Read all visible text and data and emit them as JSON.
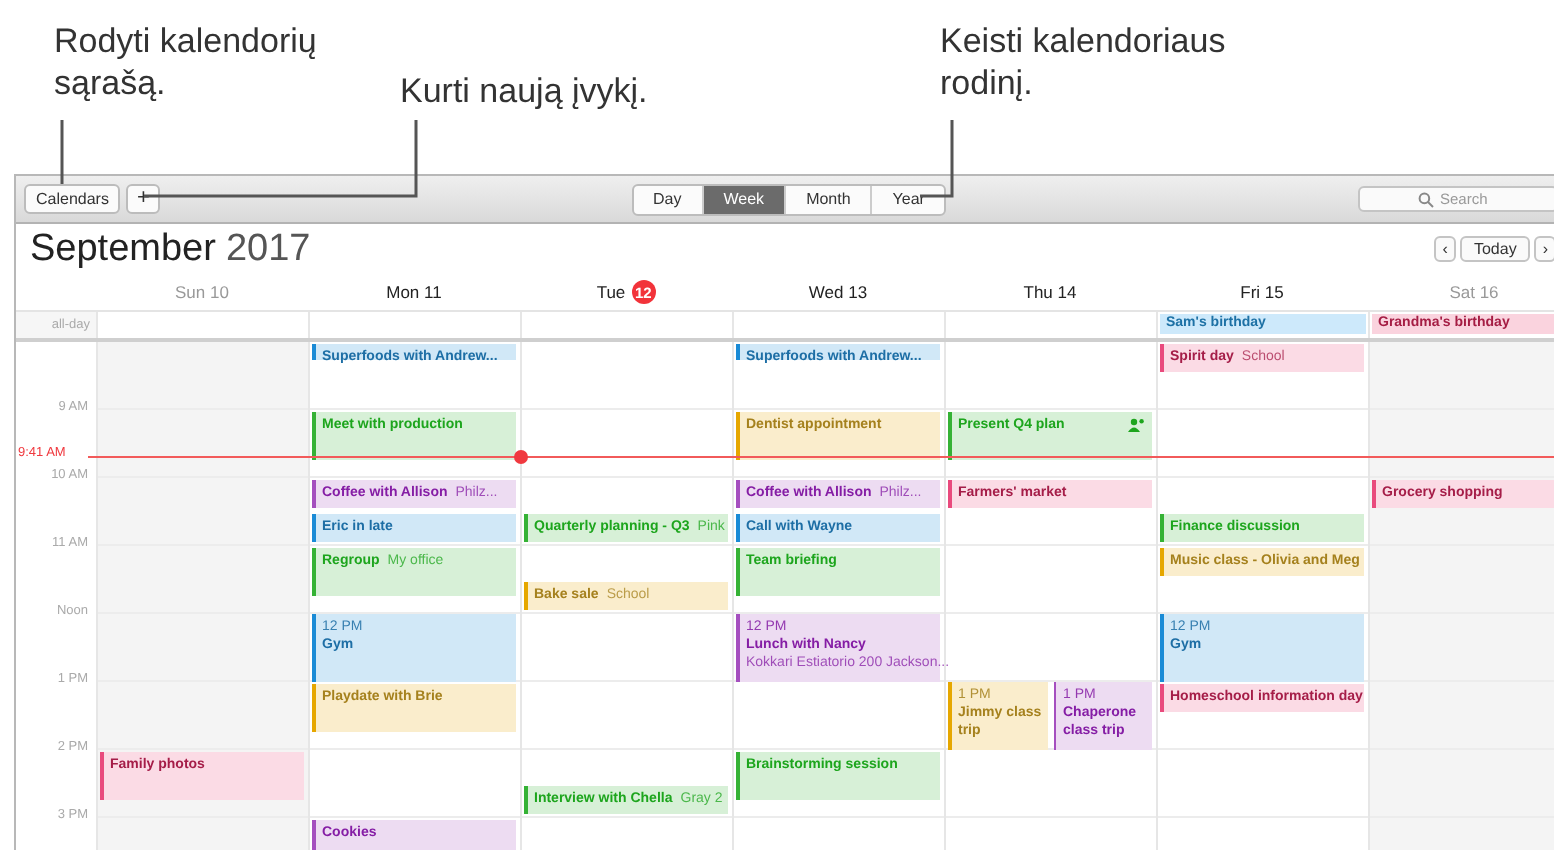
{
  "annotations": [
    {
      "text": "Rodyti kalendorių sąrašą."
    },
    {
      "text": "Kurti naują įvykį."
    },
    {
      "text": "Keisti kalendoriaus rodinį."
    }
  ],
  "toolbar": {
    "calendars_button": "Calendars",
    "add_button": "+",
    "views": [
      {
        "label": "Day",
        "selected": false
      },
      {
        "label": "Week",
        "selected": true
      },
      {
        "label": "Month",
        "selected": false
      },
      {
        "label": "Year",
        "selected": false
      }
    ],
    "search": {
      "placeholder": "Search"
    }
  },
  "header": {
    "month": "September",
    "year": "2017",
    "prev": "‹",
    "today_button": "Today",
    "next": "›"
  },
  "all_day_label": "all-day",
  "days": [
    {
      "weekday": "Sun",
      "date": "10",
      "weekend": true,
      "today": false
    },
    {
      "weekday": "Mon",
      "date": "11",
      "weekend": false,
      "today": false
    },
    {
      "weekday": "Tue",
      "date": "12",
      "weekend": false,
      "today": true
    },
    {
      "weekday": "Wed",
      "date": "13",
      "weekend": false,
      "today": false
    },
    {
      "weekday": "Thu",
      "date": "14",
      "weekend": false,
      "today": false
    },
    {
      "weekday": "Fri",
      "date": "15",
      "weekend": false,
      "today": false,
      "all_day": [
        {
          "title": "Sam's birthday",
          "color": "#cde9fb"
        }
      ]
    },
    {
      "weekday": "Sat",
      "date": "16",
      "weekend": true,
      "today": false,
      "all_day": [
        {
          "title": "Grandma's birthday",
          "color": "#fad3de"
        }
      ]
    }
  ],
  "now": {
    "label": "9:41 AM"
  },
  "rows": [
    {
      "cells": [
        {},
        {
          "events": [
            {
              "title": "Superfoods with Andrew...",
              "color": "#1a8bd6",
              "kind": "brief",
              "half_past": false,
              "invitees": false
            }
          ]
        },
        {},
        {
          "events": [
            {
              "title": "Superfoods with Andrew...",
              "color": "#1a8bd6",
              "kind": "brief",
              "half_past": false,
              "invitees": false
            }
          ]
        },
        {},
        {
          "events": [
            {
              "title": "Spirit day",
              "location": "School",
              "color": "#e94a7d",
              "kind": "short",
              "half_past": false,
              "invitees": false
            }
          ]
        },
        {}
      ]
    },
    {
      "label": "9 AM",
      "cells": [
        {},
        {
          "events": [
            {
              "title": "Meet with production",
              "color": "#35b235",
              "kind": "long",
              "half_past": false,
              "invitees": false
            }
          ]
        },
        {},
        {
          "events": [
            {
              "title": "Dentist appointment",
              "color": "#e6a700",
              "kind": "long",
              "half_past": false,
              "invitees": false
            }
          ]
        },
        {
          "events": [
            {
              "title": "Present Q4 plan",
              "color": "#35b235",
              "kind": "long",
              "half_past": false,
              "invitees": true
            }
          ]
        },
        {},
        {}
      ]
    },
    {
      "label": "10 AM",
      "cells": [
        {},
        {
          "events": [
            {
              "title": "Coffee with Allison",
              "location": "Philz...",
              "color": "#a54fbf",
              "kind": "short",
              "half_past": false,
              "invitees": false
            },
            {
              "title": "Eric in late",
              "color": "#1a8bd6",
              "kind": "short",
              "half_past": true,
              "invitees": false
            }
          ]
        },
        {
          "events": [
            {
              "title": "Quarterly planning - Q3",
              "location": "Pink",
              "color": "#35b235",
              "kind": "short",
              "half_past": true,
              "invitees": false
            }
          ]
        },
        {
          "events": [
            {
              "title": "Coffee with Allison",
              "location": "Philz...",
              "color": "#a54fbf",
              "kind": "short",
              "half_past": false,
              "invitees": false
            },
            {
              "title": "Call with Wayne",
              "color": "#1a8bd6",
              "kind": "short",
              "half_past": true,
              "invitees": false
            }
          ]
        },
        {
          "events": [
            {
              "title": "Farmers' market",
              "color": "#e94a7d",
              "kind": "short",
              "half_past": false,
              "invitees": false
            }
          ]
        },
        {
          "events": [
            {
              "title": "Finance discussion",
              "color": "#35b235",
              "kind": "short",
              "half_past": true,
              "invitees": false
            }
          ]
        },
        {
          "events": [
            {
              "title": "Grocery shopping",
              "color": "#e94a7d",
              "kind": "short",
              "half_past": false,
              "invitees": false
            }
          ]
        }
      ]
    },
    {
      "label": "11 AM",
      "cells": [
        {},
        {
          "events": [
            {
              "title": "Regroup",
              "location": "My office",
              "color": "#35b235",
              "kind": "long",
              "half_past": false,
              "invitees": false
            }
          ]
        },
        {
          "events": [
            {
              "title": "Bake sale",
              "location": "School",
              "color": "#e6a700",
              "kind": "short",
              "half_past": true,
              "invitees": false
            }
          ]
        },
        {
          "events": [
            {
              "title": "Team briefing",
              "color": "#35b235",
              "kind": "long",
              "half_past": false,
              "invitees": false
            }
          ]
        },
        {},
        {
          "events": [
            {
              "title": "Music class - Olivia and Meg",
              "color": "#e6a700",
              "kind": "short",
              "half_past": false,
              "invitees": false
            }
          ]
        },
        {}
      ]
    },
    {
      "label": "Noon",
      "cells": [
        {},
        {
          "events": [
            {
              "title": "Gym",
              "time": "12 PM",
              "color": "#1a8bd6",
              "kind": "hour",
              "half_past": false,
              "invitees": false
            }
          ]
        },
        {},
        {
          "events": [
            {
              "title": "Lunch with Nancy",
              "time": "12 PM",
              "location": "Kokkari Estiatorio 200 Jackson...",
              "color": "#a54fbf",
              "kind": "hour",
              "half_past": false,
              "invitees": false
            }
          ]
        },
        {},
        {
          "events": [
            {
              "title": "Gym",
              "time": "12 PM",
              "color": "#1a8bd6",
              "kind": "hour",
              "half_past": false,
              "invitees": false
            }
          ]
        },
        {}
      ]
    },
    {
      "label": "1 PM",
      "cells": [
        {},
        {
          "events": [
            {
              "title": "Playdate with Brie",
              "color": "#e6a700",
              "kind": "long",
              "half_past": false,
              "invitees": false
            }
          ]
        },
        {},
        {},
        {
          "events": [
            {
              "title": "Jimmy class trip",
              "time": "1 PM",
              "color": "#e6a700",
              "kind": "left",
              "half_past": false,
              "invitees": false
            },
            {
              "title": "Chaperone class trip",
              "time": "1 PM",
              "color": "#a54fbf",
              "kind": "right",
              "half_past": false,
              "invitees": false
            }
          ]
        },
        {
          "events": [
            {
              "title": "Homeschool information day",
              "color": "#e94a7d",
              "kind": "short",
              "half_past": false,
              "invitees": false
            }
          ]
        },
        {}
      ]
    },
    {
      "label": "2 PM",
      "cells": [
        {
          "events": [
            {
              "title": "Family photos",
              "color": "#e94a7d",
              "kind": "long",
              "half_past": false,
              "invitees": false
            }
          ]
        },
        {},
        {
          "events": [
            {
              "title": "Interview with Chella",
              "location": "Gray 2",
              "color": "#35b235",
              "kind": "short",
              "half_past": true,
              "invitees": false
            }
          ]
        },
        {
          "events": [
            {
              "title": "Brainstorming session",
              "color": "#35b235",
              "kind": "long",
              "half_past": false,
              "invitees": false
            }
          ]
        },
        {},
        {},
        {}
      ]
    },
    {
      "label": "3 PM",
      "cells": [
        {},
        {
          "events": [
            {
              "title": "Cookies",
              "color": "#a54fbf",
              "kind": "long",
              "half_past": false,
              "invitees": false
            }
          ]
        },
        {},
        {},
        {},
        {},
        {}
      ]
    }
  ]
}
